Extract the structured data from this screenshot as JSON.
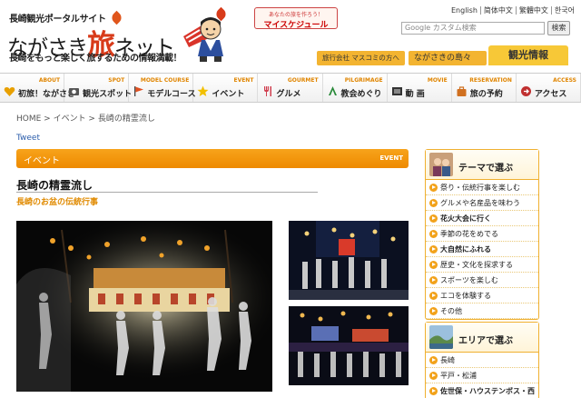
{
  "header": {
    "site_tag": "長崎観光ポータルサイト",
    "logo_pre": "ながさき",
    "logo_tabi": "旅",
    "logo_net": "ネット",
    "tagline": "長崎をもっと楽しく旅するための情報満載！",
    "my_schedule_small": "あなたの旅を作ろう！",
    "my_schedule_label": "マイスケジュール",
    "languages": [
      "English",
      "简体中文",
      "繁體中文",
      "한국어"
    ],
    "search_placeholder": "Google カスタム検索",
    "search_button": "検索",
    "tab_agency": "旅行会社 マスコミの方へ",
    "tab_islands": "ながさきの島々",
    "tab_tourism": "観光情報"
  },
  "nav": [
    {
      "sub": "ABOUT",
      "label": "初旅！ながさき",
      "icon": "heart-icon",
      "color": "#e8a000"
    },
    {
      "sub": "SPOT",
      "label": "観光スポット",
      "icon": "camera-icon",
      "color": "#555555"
    },
    {
      "sub": "MODEL COURSE",
      "label": "モデルコース",
      "icon": "flag-icon",
      "color": "#e05020"
    },
    {
      "sub": "EVENT",
      "label": "イベント",
      "icon": "star-icon",
      "color": "#f2c000"
    },
    {
      "sub": "GOURMET",
      "label": "グルメ",
      "icon": "fork-icon",
      "color": "#d04050"
    },
    {
      "sub": "PILGRIMAGE",
      "label": "教会めぐり",
      "icon": "church-icon",
      "color": "#2a8a3a"
    },
    {
      "sub": "MOVIE",
      "label": "動 画",
      "icon": "film-icon",
      "color": "#333333"
    },
    {
      "sub": "RESERVATION",
      "label": "旅の予約",
      "icon": "bag-icon",
      "color": "#d07020"
    },
    {
      "sub": "ACCESS",
      "label": "アクセス",
      "icon": "access-icon",
      "color": "#c03030"
    }
  ],
  "breadcrumb": "HOME > イベント > 長崎の精霊流し",
  "tweet": "Tweet",
  "event_bar": {
    "left": "イベント",
    "right": "EVENT"
  },
  "article": {
    "title": "長崎の精霊流し",
    "subtitle": "長崎のお盆の伝統行事"
  },
  "sidebar_theme": {
    "title": "テーマで選ぶ",
    "items": [
      {
        "label": "祭り・伝統行事を楽しむ",
        "bold": false
      },
      {
        "label": "グルメや名産品を味わう",
        "bold": false
      },
      {
        "label": "花火大会に行く",
        "bold": true
      },
      {
        "label": "季節の花をめでる",
        "bold": false
      },
      {
        "label": "大自然にふれる",
        "bold": true
      },
      {
        "label": "歴史・文化を探求する",
        "bold": false
      },
      {
        "label": "スポーツを楽しむ",
        "bold": false
      },
      {
        "label": "エコを体験する",
        "bold": false
      },
      {
        "label": "その他",
        "bold": false
      }
    ]
  },
  "sidebar_area": {
    "title": "エリアで選ぶ",
    "items": [
      {
        "label": "長崎",
        "bold": false
      },
      {
        "label": "平戸・松浦",
        "bold": false
      },
      {
        "label": "佐世保・ハウステンボス・西",
        "bold": true
      }
    ]
  }
}
